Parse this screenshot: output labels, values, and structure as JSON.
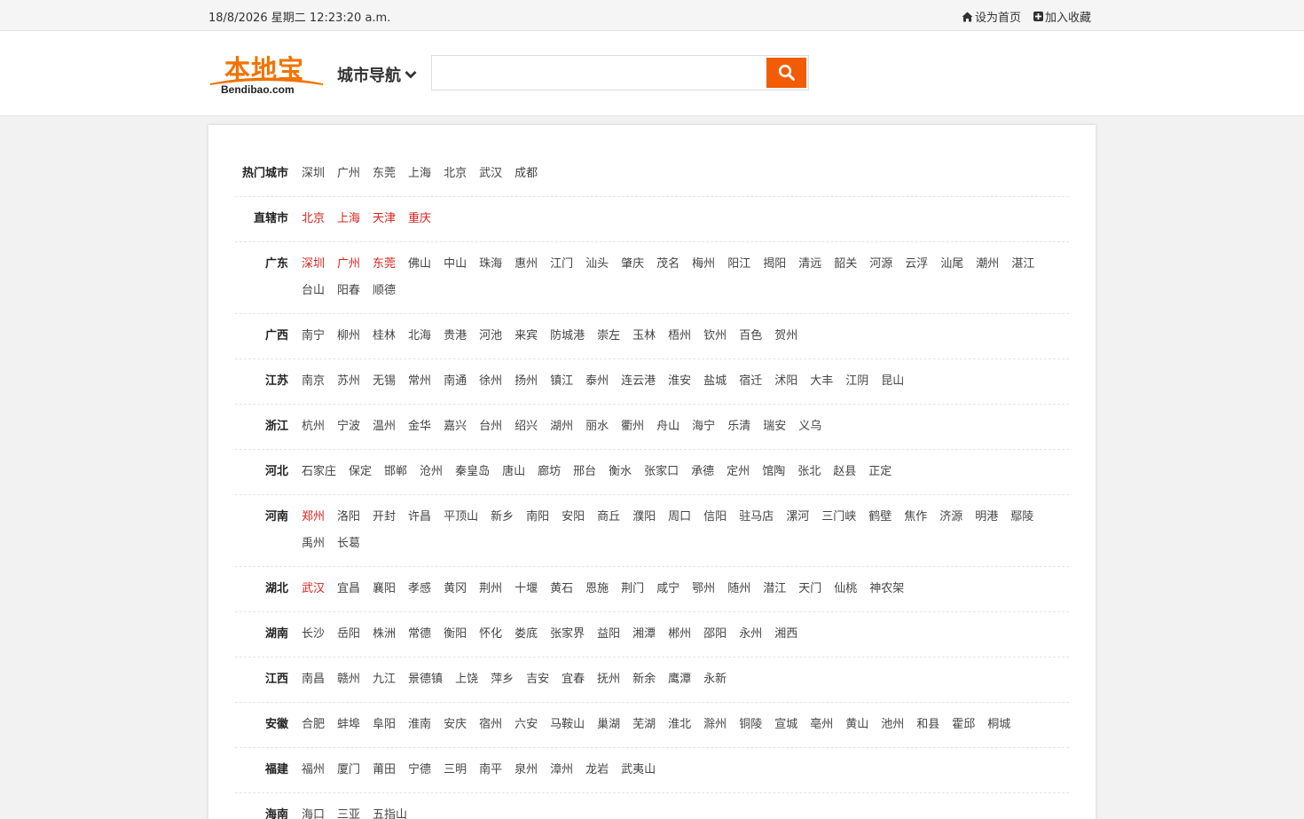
{
  "topbar": {
    "datetime": "18/8/2026 星期二 12:23:20 a.m.",
    "set_home": "设为首页",
    "bookmark": "加入收藏"
  },
  "header": {
    "logo_cn": "本地宝",
    "logo_en": "Bendibao.com",
    "city_nav": "城市导航",
    "search_placeholder": ""
  },
  "colors": {
    "accent": "#f25c05",
    "logo": "#f27300",
    "highlight": "#d8231e"
  },
  "regions": [
    {
      "name": "热门城市",
      "cities": [
        [
          "深圳",
          0
        ],
        [
          "广州",
          0
        ],
        [
          "东莞",
          0
        ],
        [
          "上海",
          0
        ],
        [
          "北京",
          0
        ],
        [
          "武汉",
          0
        ],
        [
          "成都",
          0
        ]
      ]
    },
    {
      "name": "直辖市",
      "cities": [
        [
          "北京",
          1
        ],
        [
          "上海",
          1
        ],
        [
          "天津",
          1
        ],
        [
          "重庆",
          1
        ]
      ]
    },
    {
      "name": "广东",
      "cities": [
        [
          "深圳",
          1
        ],
        [
          "广州",
          1
        ],
        [
          "东莞",
          1
        ],
        [
          "佛山",
          0
        ],
        [
          "中山",
          0
        ],
        [
          "珠海",
          0
        ],
        [
          "惠州",
          0
        ],
        [
          "江门",
          0
        ],
        [
          "汕头",
          0
        ],
        [
          "肇庆",
          0
        ],
        [
          "茂名",
          0
        ],
        [
          "梅州",
          0
        ],
        [
          "阳江",
          0
        ],
        [
          "揭阳",
          0
        ],
        [
          "清远",
          0
        ],
        [
          "韶关",
          0
        ],
        [
          "河源",
          0
        ],
        [
          "云浮",
          0
        ],
        [
          "汕尾",
          0
        ],
        [
          "潮州",
          0
        ],
        [
          "湛江",
          0
        ],
        [
          "台山",
          0
        ],
        [
          "阳春",
          0
        ],
        [
          "顺德",
          0
        ]
      ]
    },
    {
      "name": "广西",
      "cities": [
        [
          "南宁",
          0
        ],
        [
          "柳州",
          0
        ],
        [
          "桂林",
          0
        ],
        [
          "北海",
          0
        ],
        [
          "贵港",
          0
        ],
        [
          "河池",
          0
        ],
        [
          "来宾",
          0
        ],
        [
          "防城港",
          0
        ],
        [
          "崇左",
          0
        ],
        [
          "玉林",
          0
        ],
        [
          "梧州",
          0
        ],
        [
          "钦州",
          0
        ],
        [
          "百色",
          0
        ],
        [
          "贺州",
          0
        ]
      ]
    },
    {
      "name": "江苏",
      "cities": [
        [
          "南京",
          0
        ],
        [
          "苏州",
          0
        ],
        [
          "无锡",
          0
        ],
        [
          "常州",
          0
        ],
        [
          "南通",
          0
        ],
        [
          "徐州",
          0
        ],
        [
          "扬州",
          0
        ],
        [
          "镇江",
          0
        ],
        [
          "泰州",
          0
        ],
        [
          "连云港",
          0
        ],
        [
          "淮安",
          0
        ],
        [
          "盐城",
          0
        ],
        [
          "宿迁",
          0
        ],
        [
          "沭阳",
          0
        ],
        [
          "大丰",
          0
        ],
        [
          "江阴",
          0
        ],
        [
          "昆山",
          0
        ]
      ]
    },
    {
      "name": "浙江",
      "cities": [
        [
          "杭州",
          0
        ],
        [
          "宁波",
          0
        ],
        [
          "温州",
          0
        ],
        [
          "金华",
          0
        ],
        [
          "嘉兴",
          0
        ],
        [
          "台州",
          0
        ],
        [
          "绍兴",
          0
        ],
        [
          "湖州",
          0
        ],
        [
          "丽水",
          0
        ],
        [
          "衢州",
          0
        ],
        [
          "舟山",
          0
        ],
        [
          "海宁",
          0
        ],
        [
          "乐清",
          0
        ],
        [
          "瑞安",
          0
        ],
        [
          "义乌",
          0
        ]
      ]
    },
    {
      "name": "河北",
      "cities": [
        [
          "石家庄",
          0
        ],
        [
          "保定",
          0
        ],
        [
          "邯郸",
          0
        ],
        [
          "沧州",
          0
        ],
        [
          "秦皇岛",
          0
        ],
        [
          "唐山",
          0
        ],
        [
          "廊坊",
          0
        ],
        [
          "邢台",
          0
        ],
        [
          "衡水",
          0
        ],
        [
          "张家口",
          0
        ],
        [
          "承德",
          0
        ],
        [
          "定州",
          0
        ],
        [
          "馆陶",
          0
        ],
        [
          "张北",
          0
        ],
        [
          "赵县",
          0
        ],
        [
          "正定",
          0
        ]
      ]
    },
    {
      "name": "河南",
      "cities": [
        [
          "郑州",
          1
        ],
        [
          "洛阳",
          0
        ],
        [
          "开封",
          0
        ],
        [
          "许昌",
          0
        ],
        [
          "平顶山",
          0
        ],
        [
          "新乡",
          0
        ],
        [
          "南阳",
          0
        ],
        [
          "安阳",
          0
        ],
        [
          "商丘",
          0
        ],
        [
          "濮阳",
          0
        ],
        [
          "周口",
          0
        ],
        [
          "信阳",
          0
        ],
        [
          "驻马店",
          0
        ],
        [
          "漯河",
          0
        ],
        [
          "三门峡",
          0
        ],
        [
          "鹤壁",
          0
        ],
        [
          "焦作",
          0
        ],
        [
          "济源",
          0
        ],
        [
          "明港",
          0
        ],
        [
          "鄢陵",
          0
        ],
        [
          "禹州",
          0
        ],
        [
          "长葛",
          0
        ]
      ]
    },
    {
      "name": "湖北",
      "cities": [
        [
          "武汉",
          1
        ],
        [
          "宜昌",
          0
        ],
        [
          "襄阳",
          0
        ],
        [
          "孝感",
          0
        ],
        [
          "黄冈",
          0
        ],
        [
          "荆州",
          0
        ],
        [
          "十堰",
          0
        ],
        [
          "黄石",
          0
        ],
        [
          "恩施",
          0
        ],
        [
          "荆门",
          0
        ],
        [
          "咸宁",
          0
        ],
        [
          "鄂州",
          0
        ],
        [
          "随州",
          0
        ],
        [
          "潜江",
          0
        ],
        [
          "天门",
          0
        ],
        [
          "仙桃",
          0
        ],
        [
          "神农架",
          0
        ]
      ]
    },
    {
      "name": "湖南",
      "cities": [
        [
          "长沙",
          0
        ],
        [
          "岳阳",
          0
        ],
        [
          "株洲",
          0
        ],
        [
          "常德",
          0
        ],
        [
          "衡阳",
          0
        ],
        [
          "怀化",
          0
        ],
        [
          "娄底",
          0
        ],
        [
          "张家界",
          0
        ],
        [
          "益阳",
          0
        ],
        [
          "湘潭",
          0
        ],
        [
          "郴州",
          0
        ],
        [
          "邵阳",
          0
        ],
        [
          "永州",
          0
        ],
        [
          "湘西",
          0
        ]
      ]
    },
    {
      "name": "江西",
      "cities": [
        [
          "南昌",
          0
        ],
        [
          "赣州",
          0
        ],
        [
          "九江",
          0
        ],
        [
          "景德镇",
          0
        ],
        [
          "上饶",
          0
        ],
        [
          "萍乡",
          0
        ],
        [
          "吉安",
          0
        ],
        [
          "宜春",
          0
        ],
        [
          "抚州",
          0
        ],
        [
          "新余",
          0
        ],
        [
          "鹰潭",
          0
        ],
        [
          "永新",
          0
        ]
      ]
    },
    {
      "name": "安徽",
      "cities": [
        [
          "合肥",
          0
        ],
        [
          "蚌埠",
          0
        ],
        [
          "阜阳",
          0
        ],
        [
          "淮南",
          0
        ],
        [
          "安庆",
          0
        ],
        [
          "宿州",
          0
        ],
        [
          "六安",
          0
        ],
        [
          "马鞍山",
          0
        ],
        [
          "巢湖",
          0
        ],
        [
          "芜湖",
          0
        ],
        [
          "淮北",
          0
        ],
        [
          "滁州",
          0
        ],
        [
          "铜陵",
          0
        ],
        [
          "宣城",
          0
        ],
        [
          "亳州",
          0
        ],
        [
          "黄山",
          0
        ],
        [
          "池州",
          0
        ],
        [
          "和县",
          0
        ],
        [
          "霍邱",
          0
        ],
        [
          "桐城",
          0
        ]
      ]
    },
    {
      "name": "福建",
      "cities": [
        [
          "福州",
          0
        ],
        [
          "厦门",
          0
        ],
        [
          "莆田",
          0
        ],
        [
          "宁德",
          0
        ],
        [
          "三明",
          0
        ],
        [
          "南平",
          0
        ],
        [
          "泉州",
          0
        ],
        [
          "漳州",
          0
        ],
        [
          "龙岩",
          0
        ],
        [
          "武夷山",
          0
        ]
      ]
    },
    {
      "name": "海南",
      "cities": [
        [
          "海口",
          0
        ],
        [
          "三亚",
          0
        ],
        [
          "五指山",
          0
        ]
      ]
    }
  ]
}
